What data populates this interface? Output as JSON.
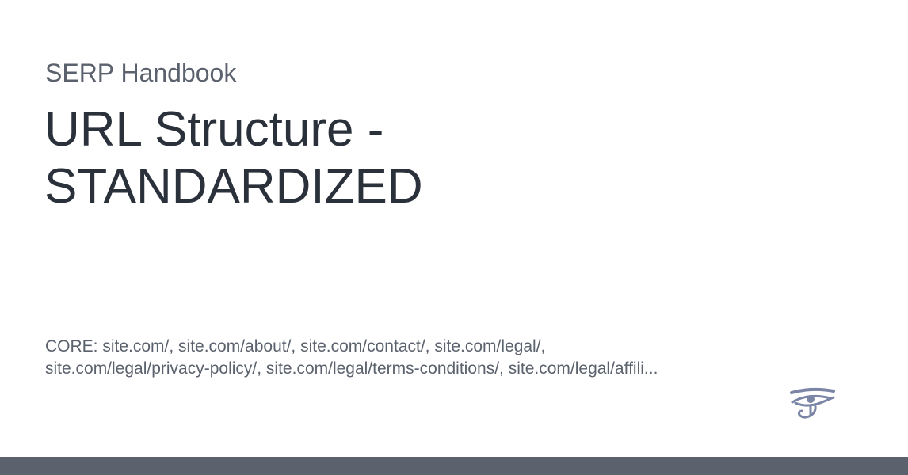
{
  "site": {
    "name": "SERP Handbook"
  },
  "page": {
    "title": "URL Structure - STANDARDIZED",
    "description": "CORE: site.com/, site.com/about/, site.com/contact/, site.com/legal/,\nsite.com/legal/privacy-policy/, site.com/legal/terms-conditions/, site.com/legal/affili..."
  },
  "logo": {
    "icon": "eye-of-horus-icon",
    "color": "#7b86a6"
  },
  "colors": {
    "bottom_bar": "#5b626d",
    "title": "#2b313b",
    "muted_text": "#5b626d",
    "background": "#ffffff"
  }
}
